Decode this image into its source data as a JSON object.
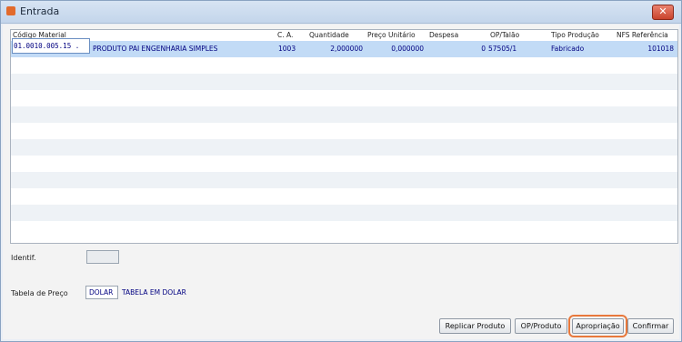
{
  "window": {
    "title": "Entrada",
    "close_icon": "close-icon"
  },
  "grid": {
    "columns": [
      "Código Material",
      "C. A.",
      "Quantidade",
      "Preço Unitário",
      "Despesa",
      "OP/Talão",
      "Tipo Produção",
      "NFS Referência"
    ],
    "rows": [
      {
        "codigo": "01.0010.005.15 .",
        "descricao": "PRODUTO PAI ENGENHARIA SIMPLES",
        "ca": "1003",
        "quantidade": "2,000000",
        "preco_unitario": "0,000000",
        "despesa": "0",
        "op_talao": "57505/1",
        "tipo_producao": "Fabricado",
        "nfs_referencia": "101018"
      }
    ]
  },
  "form": {
    "identif_label": "Identif.",
    "tabela_preco_label": "Tabela de Preço",
    "tabela_preco_value": "DOLAR",
    "tabela_preco_desc": "TABELA EM DOLAR"
  },
  "buttons": {
    "replicar": "Replicar Produto",
    "op_produto": "OP/Produto",
    "apropriacao": "Apropriação",
    "confirmar": "Confirmar"
  },
  "colors": {
    "selection": "#c2dbf6",
    "focus_outline": "#e8783c",
    "text_blue": "#000080"
  }
}
